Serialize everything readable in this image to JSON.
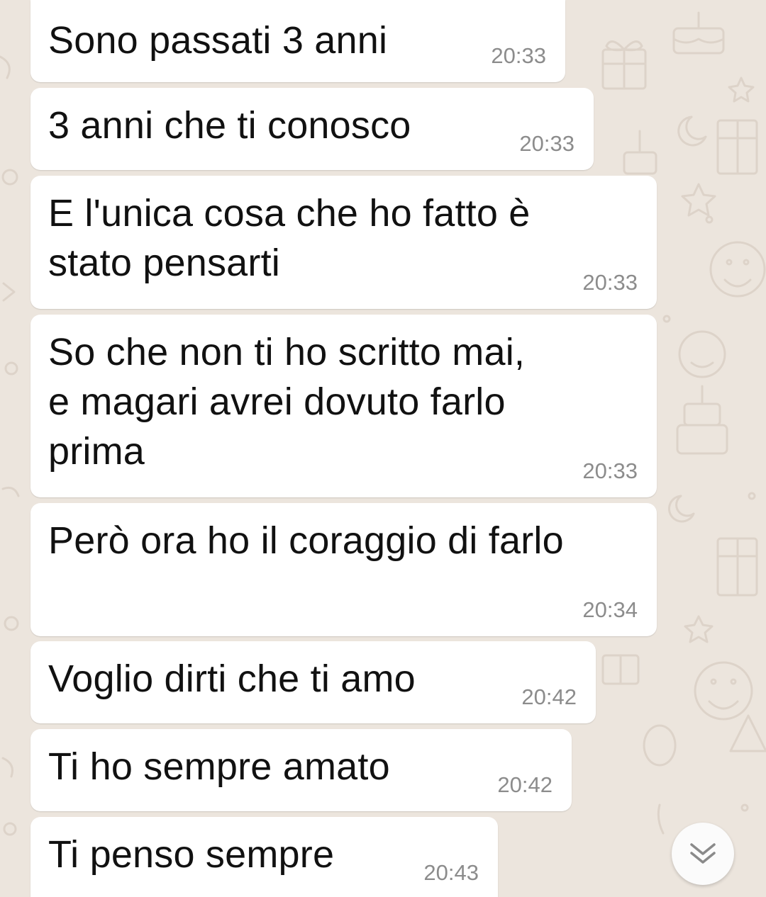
{
  "theme": {
    "chat_background": "#ece5dd",
    "bubble_background": "#ffffff",
    "text_color": "#111111",
    "time_color": "#8c8c8c"
  },
  "messages": [
    {
      "text": "Sono passati 3 anni",
      "time": "20:33"
    },
    {
      "text": "3 anni che ti conosco",
      "time": "20:33"
    },
    {
      "text": "E l'unica cosa che ho fatto è\nstato pensarti",
      "time": "20:33"
    },
    {
      "text": "So che non ti ho scritto mai,\ne magari avrei dovuto farlo\nprima",
      "time": "20:33"
    },
    {
      "text": "Però ora ho il coraggio di farlo",
      "time": "20:34"
    },
    {
      "text": "Voglio dirti che ti amo",
      "time": "20:42"
    },
    {
      "text": "Ti ho sempre amato",
      "time": "20:42"
    },
    {
      "text": "Ti penso sempre",
      "time": "20:43"
    }
  ],
  "scroll_button": {
    "icon": "double-chevron-down-icon"
  }
}
